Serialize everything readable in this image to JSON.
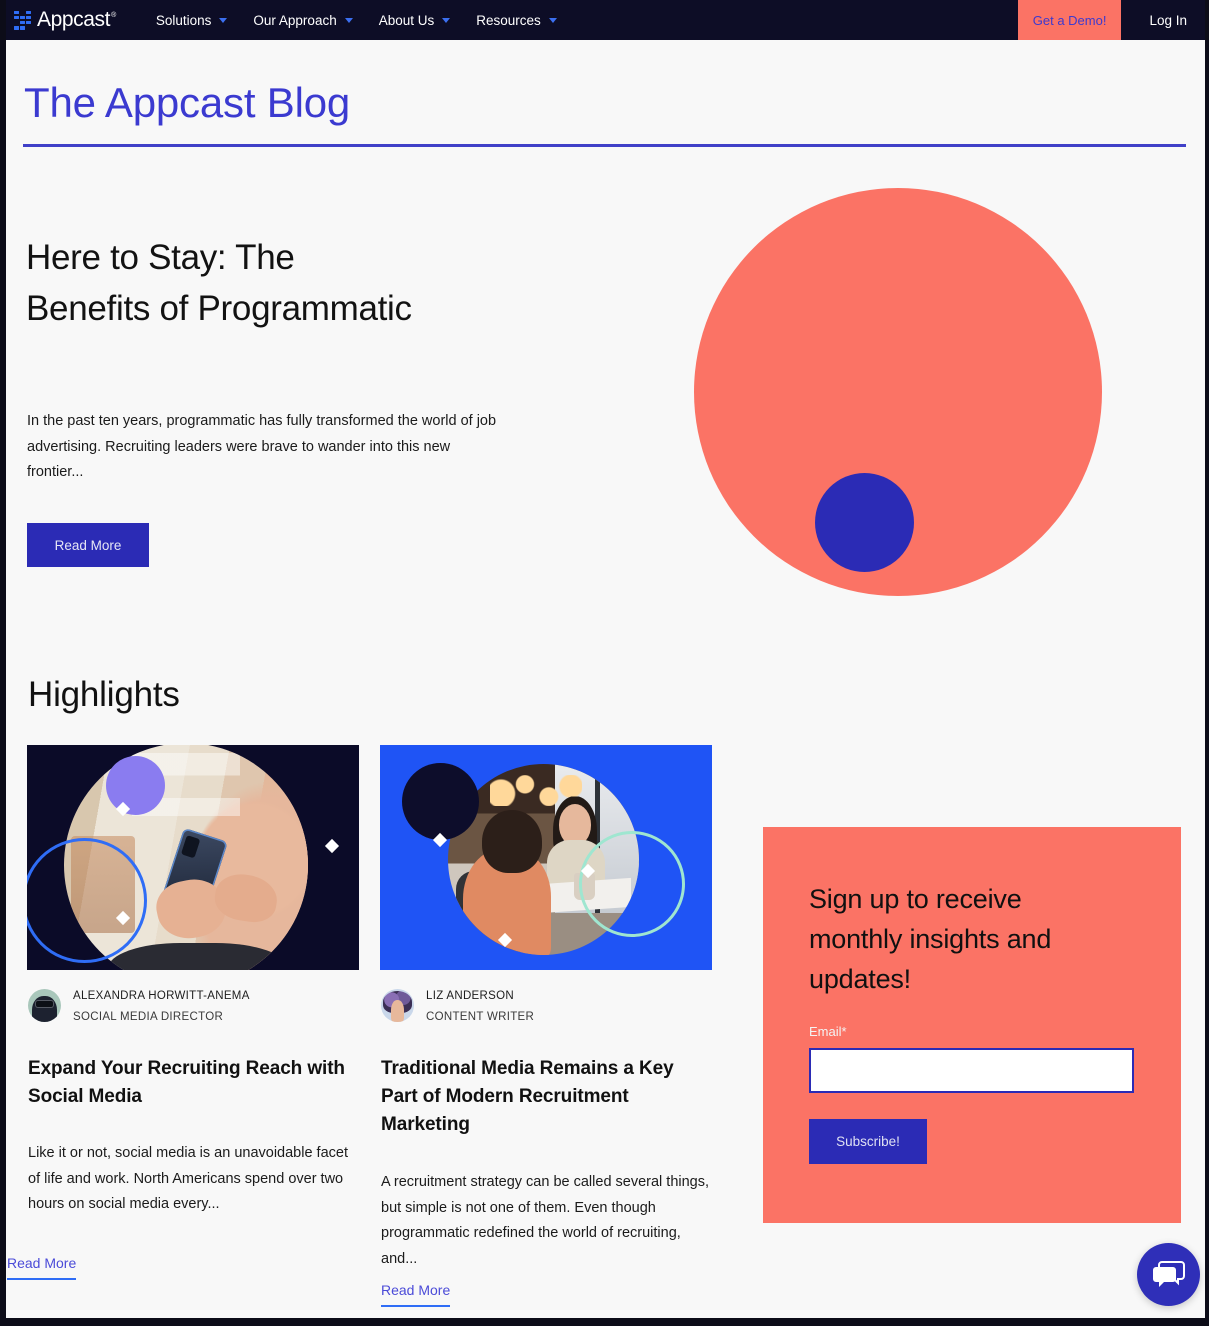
{
  "navbar": {
    "logo_text": "Appcast",
    "logo_icon": "appcast-dot-grid-icon",
    "links": [
      {
        "label": "Solutions",
        "caret": "chevron-down-icon"
      },
      {
        "label": "Our Approach",
        "caret": "chevron-down-icon"
      },
      {
        "label": "About Us",
        "caret": "chevron-down-icon"
      },
      {
        "label": "Resources",
        "caret": "chevron-down-icon"
      }
    ],
    "demo_button": "Get a Demo!",
    "login_link": "Log In"
  },
  "page": {
    "title": "The Appcast Blog"
  },
  "hero": {
    "headline": "Here to Stay: The Benefits of Programmatic",
    "excerpt": "In the past ten years, programmatic has fully transformed the world of job advertising. Recruiting leaders were brave to wander into this new frontier...",
    "read_more": "Read More",
    "graphic": {
      "large_circle_color": "#fb7365",
      "small_circle_color": "#2b2bb5"
    }
  },
  "highlights": {
    "heading": "Highlights",
    "cards": [
      {
        "image_background": "#0b0b28",
        "accent_circle_color": "#8a7cf0",
        "accent_ring_color": "#2f6df6",
        "author_name": "ALEXANDRA HORWITT-ANEMA",
        "author_role": "SOCIAL MEDIA DIRECTOR",
        "title": "Expand Your Recruiting Reach with Social Media",
        "excerpt": "Like it or not, social media is an unavoidable facet of life and work. North Americans spend over two hours on social media every...",
        "read_more": "Read More"
      },
      {
        "image_background": "#1f54f5",
        "accent_circle_color": "#0d0d2b",
        "accent_ring_color": "#9fe6d0",
        "author_name": "LIZ ANDERSON",
        "author_role": "CONTENT WRITER",
        "title": "Traditional Media Remains a Key Part of Modern Recruitment Marketing",
        "excerpt": "A recruitment strategy can be called several things, but simple is not one of them. Even though programmatic redefined the world of recruiting, and...",
        "read_more": "Read More"
      }
    ]
  },
  "subscribe": {
    "heading": "Sign up to receive monthly insights and updates!",
    "email_label": "Email*",
    "email_value": "",
    "email_placeholder": "",
    "button_label": "Subscribe!",
    "panel_color": "#fb7365"
  },
  "chat": {
    "icon": "chat-bubbles-icon",
    "color": "#2f2fb8"
  },
  "colors": {
    "brand_blue": "#2b2bb5",
    "brand_coral": "#fb7365",
    "nav_dark": "#0d0d26",
    "link_blue": "#4b4bd8"
  }
}
